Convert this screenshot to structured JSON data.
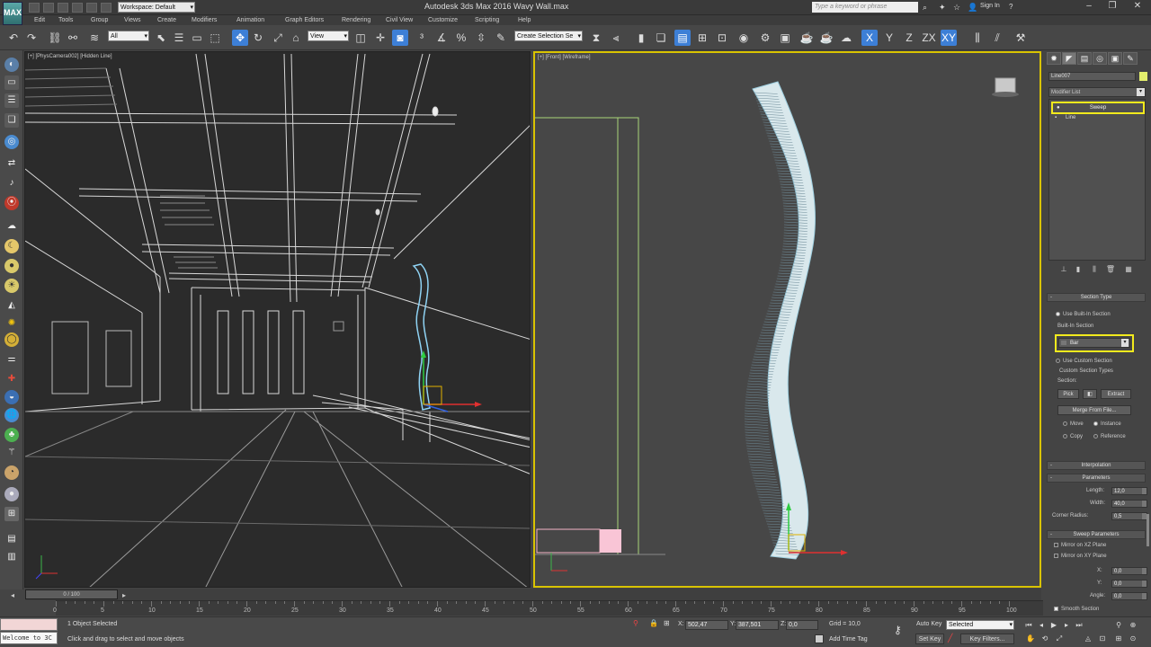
{
  "app": {
    "title": "Autodesk 3ds Max 2016    Wavy Wall.max",
    "logo": "MAX",
    "workspace": "Workspace: Default",
    "search_placeholder": "Type a keyword or phrase",
    "sign_in": "Sign In"
  },
  "menu": [
    "Edit",
    "Tools",
    "Group",
    "Views",
    "Create",
    "Modifiers",
    "Animation",
    "Graph Editors",
    "Rendering",
    "Civil View",
    "Customize",
    "Scripting",
    "Help"
  ],
  "toolbar": {
    "selection_filter": "All",
    "ref_coord": "View",
    "named_selection": "Create Selection Se",
    "axis_x": "X",
    "axis_y": "Y",
    "axis_z": "Z",
    "axis_zx": "ZX",
    "axis_xy": "XY"
  },
  "viewports": {
    "left_label": "[+] [PhysCamera002] [Hidden Line]",
    "right_label": "[+] [Front] [Wireframe]"
  },
  "command_panel": {
    "object_name": "Line007",
    "object_color": "#e4f06d",
    "modifier_list": "Modifier List",
    "stack": [
      "Sweep",
      "Line"
    ],
    "section_type": {
      "title": "Section Type",
      "use_builtin": "Use Built-In Section",
      "builtin_group": "Built-In Section",
      "builtin_value": "Bar",
      "use_custom": "Use Custom Section",
      "custom_group": "Custom Section Types",
      "section_label": "Section:",
      "pick": "Pick",
      "extract": "Extract",
      "merge": "Merge From File...",
      "move": "Move",
      "instance": "Instance",
      "copy": "Copy",
      "reference": "Reference"
    },
    "interpolation": "Interpolation",
    "parameters": {
      "title": "Parameters",
      "length_label": "Length:",
      "length": "12,0",
      "width_label": "Width:",
      "width": "40,0",
      "corner_label": "Corner Radius:",
      "corner": "0,5"
    },
    "sweep_parameters": {
      "title": "Sweep Parameters",
      "mirror_xz": "Mirror on XZ Plane",
      "mirror_xy": "Mirror on XY Plane",
      "x_label": "X:",
      "x": "0,0",
      "y_label": "Y:",
      "y": "0,0",
      "angle_label": "Angle:",
      "angle": "0,0",
      "smooth": "Smooth Section"
    }
  },
  "timeline": {
    "slider": "0 / 100",
    "ticks": [
      "0",
      "5",
      "10",
      "15",
      "20",
      "25",
      "30",
      "35",
      "40",
      "45",
      "50",
      "55",
      "60",
      "65",
      "70",
      "75",
      "80",
      "85",
      "90",
      "95",
      "100"
    ]
  },
  "status": {
    "maxscript": "Welcome to 3C",
    "selected": "1 Object Selected",
    "prompt": "Click and drag to select and move objects",
    "x_label": "X:",
    "x": "502,47",
    "y_label": "Y:",
    "y": "387,501",
    "z_label": "Z:",
    "z": "0,0",
    "grid": "Grid = 10,0",
    "add_time_tag": "Add Time Tag",
    "auto_key": "Auto Key",
    "set_key": "Set Key",
    "selection_set": "Selected",
    "key_filters": "Key Filters..."
  },
  "colors": {
    "selection_highlight": "#f2ea1d",
    "active_viewport": "#d9c300",
    "wall_wire": "#9ecfe0",
    "tool_active": "#3d7fd6"
  }
}
